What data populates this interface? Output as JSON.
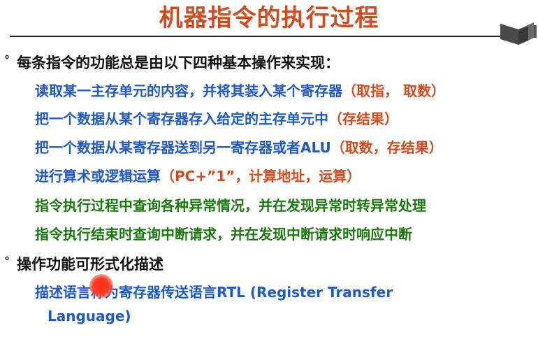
{
  "slide": {
    "title": "机器指令的执行过程",
    "bullets": [
      {
        "text": "每条指令的功能总是由以下四种基本操作来实现：",
        "items": [
          {
            "text": "读取某一主存单元的内容，并将其装入某个寄存器",
            "suffix": "（取指， 取数）",
            "color": "#1f58c7"
          },
          {
            "text": "把一个数据从某个寄存器存入给定的主存单元中",
            "suffix": "（存结果）",
            "color": "#1f58c7"
          },
          {
            "text": "把一个数据从某寄存器送到另一寄存器或者ALU",
            "suffix": "（取数，存结果）",
            "color": "#1f58c7"
          },
          {
            "text": "进行算术或逻辑运算",
            "suffix": "（PC+”1”，计算地址，运算）",
            "color": "#1f58c7"
          },
          {
            "text": "指令执行过程中查询各种异常情况，并在发现异常时转异常处理",
            "suffix": "",
            "color": "#1a7a0f"
          },
          {
            "text": "指令执行结束时查询中断请求，并在发现中断请求时响应中断",
            "suffix": "",
            "color": "#1a7a0f"
          }
        ]
      },
      {
        "text": "操作功能可形式化描述",
        "items": [
          {
            "text": "描述语言称为寄存器传送语言RTL (Register Transfer",
            "suffix": "",
            "color": "#1f58c7"
          },
          {
            "text": "Language)",
            "suffix": "",
            "color": "#1f58c7"
          }
        ]
      }
    ],
    "colors": {
      "title": "#d24a1e",
      "blue_text": "#1f58c7",
      "green_text": "#1a7a0f",
      "paren_accent": "#d24a1e",
      "laser_pointer": "#ff2a1a"
    },
    "icons": {
      "logo": "book-logo-icon",
      "pointer": "laser-pointer-dot"
    }
  }
}
